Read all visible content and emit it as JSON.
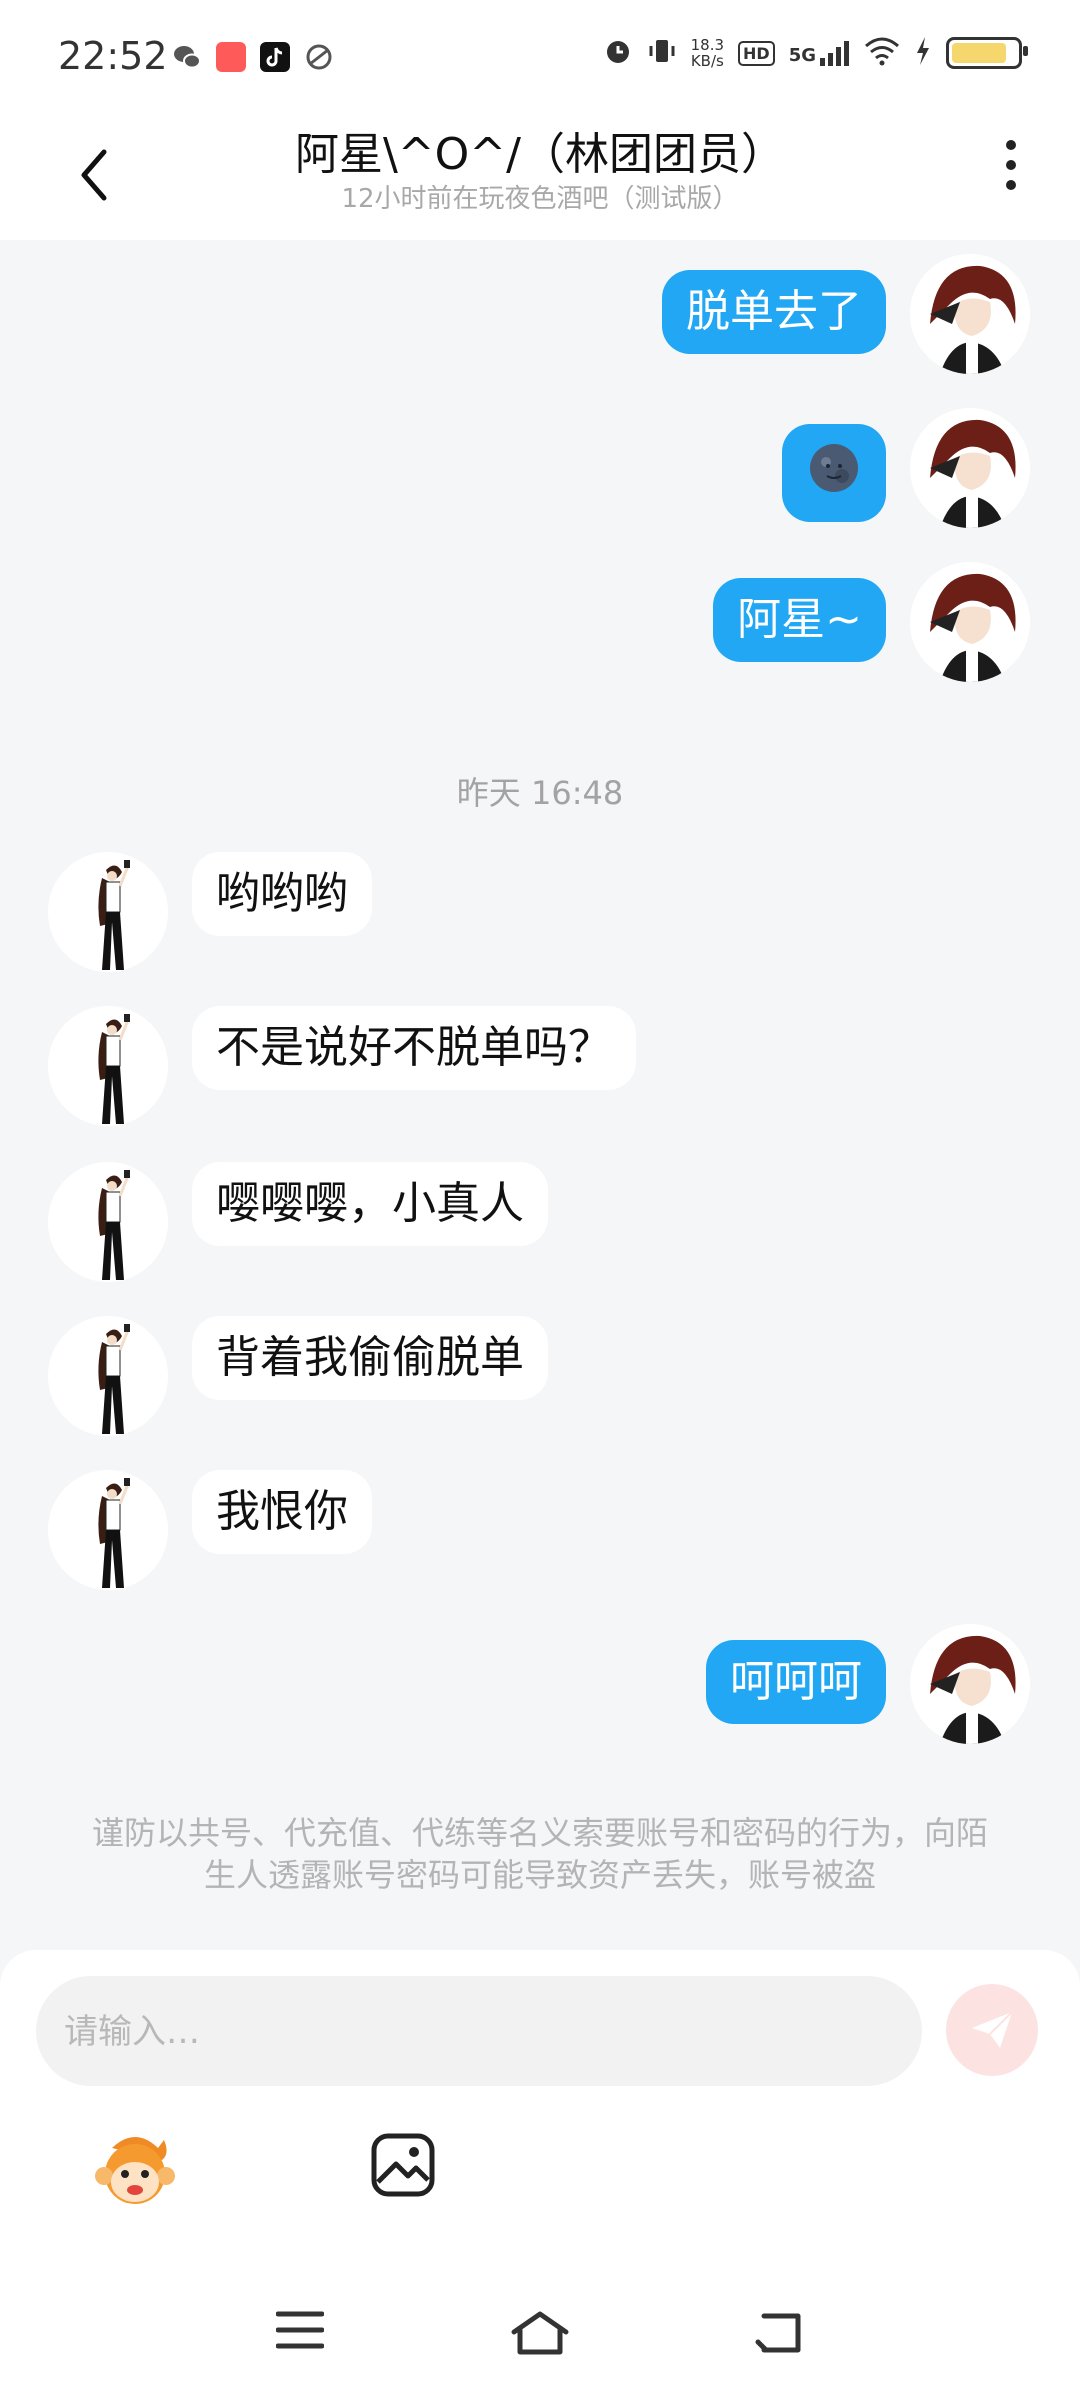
{
  "status_bar": {
    "time": "22:52",
    "net_speed_value": "18.3",
    "net_speed_unit": "KB/s",
    "hd_label": "HD",
    "network_label": "5G",
    "icons": [
      "wechat-icon",
      "app-icon",
      "tiktok-icon",
      "browser-icon",
      "alarm-icon",
      "vibrate-icon",
      "signal-icon",
      "wifi-icon",
      "charging-icon",
      "battery-icon"
    ]
  },
  "header": {
    "title": "阿星\\^O^/（林团团员）",
    "subtitle": "12小时前在玩夜色酒吧（测试版）"
  },
  "messages_before": [
    {
      "text": "脱单去了"
    },
    {
      "text": "🌚"
    },
    {
      "text": "阿星~"
    }
  ],
  "timestamp": "昨天 16:48",
  "messages_incoming": [
    {
      "text": "哟哟哟"
    },
    {
      "text": "不是说好不脱单吗？"
    },
    {
      "text": "嘤嘤嘤，小真人"
    },
    {
      "text": "背着我偷偷脱单"
    },
    {
      "text": "我恨你"
    }
  ],
  "message_after": {
    "text": "呵呵呵"
  },
  "notice": "谨防以共号、代充值、代练等名义索要账号和密码的行为，向陌生人透露账号密码可能导致资产丢失，账号被盗",
  "input": {
    "placeholder": "请输入…",
    "value": ""
  },
  "colors": {
    "outgoing_bubble": "#21a7f4",
    "incoming_bubble": "#ffffff",
    "background": "#f5f6f8",
    "send_button": "#fde2e2"
  }
}
